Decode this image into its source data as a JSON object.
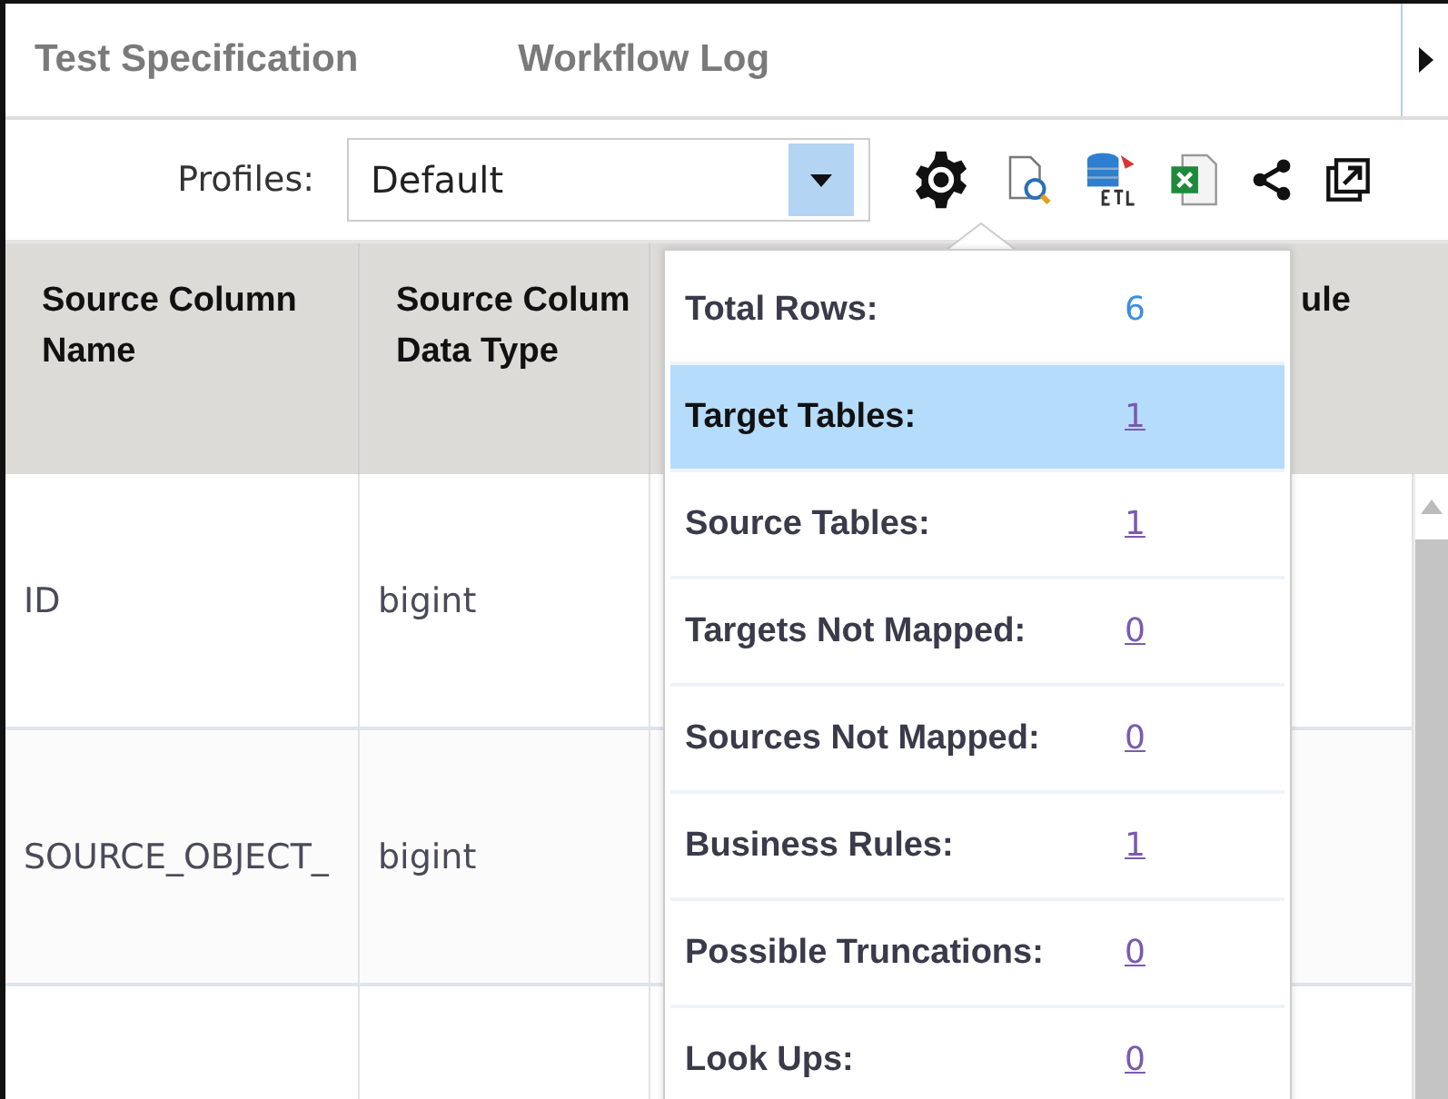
{
  "tabs": [
    {
      "label": "Test Specification",
      "selected": false
    },
    {
      "label": "Workflow Log",
      "selected": false
    }
  ],
  "toolbar": {
    "profiles_label": "Profiles:",
    "profile_select": {
      "value": "Default"
    }
  },
  "table": {
    "columns": [
      {
        "label": "Source Column Name"
      },
      {
        "label": "Source Colum Data Type"
      },
      {
        "label": "ule"
      }
    ],
    "rows": [
      {
        "cells": [
          "ID",
          "bigint"
        ]
      },
      {
        "cells": [
          "SOURCE_OBJECT_",
          "bigint"
        ]
      }
    ]
  },
  "summary_popup": {
    "items": [
      {
        "label": "Total Rows:",
        "value": "6",
        "kind": "count",
        "selected": false
      },
      {
        "label": "Target Tables:",
        "value": "1",
        "kind": "link",
        "selected": true
      },
      {
        "label": "Source Tables:",
        "value": "1",
        "kind": "link",
        "selected": false
      },
      {
        "label": "Targets Not Mapped:",
        "value": "0",
        "kind": "link",
        "selected": false
      },
      {
        "label": "Sources Not Mapped:",
        "value": "0",
        "kind": "link",
        "selected": false
      },
      {
        "label": "Business Rules:",
        "value": "1",
        "kind": "link",
        "selected": false
      },
      {
        "label": "Possible Truncations:",
        "value": "0",
        "kind": "link",
        "selected": false
      },
      {
        "label": "Look Ups:",
        "value": "0",
        "kind": "link",
        "selected": false
      }
    ]
  }
}
